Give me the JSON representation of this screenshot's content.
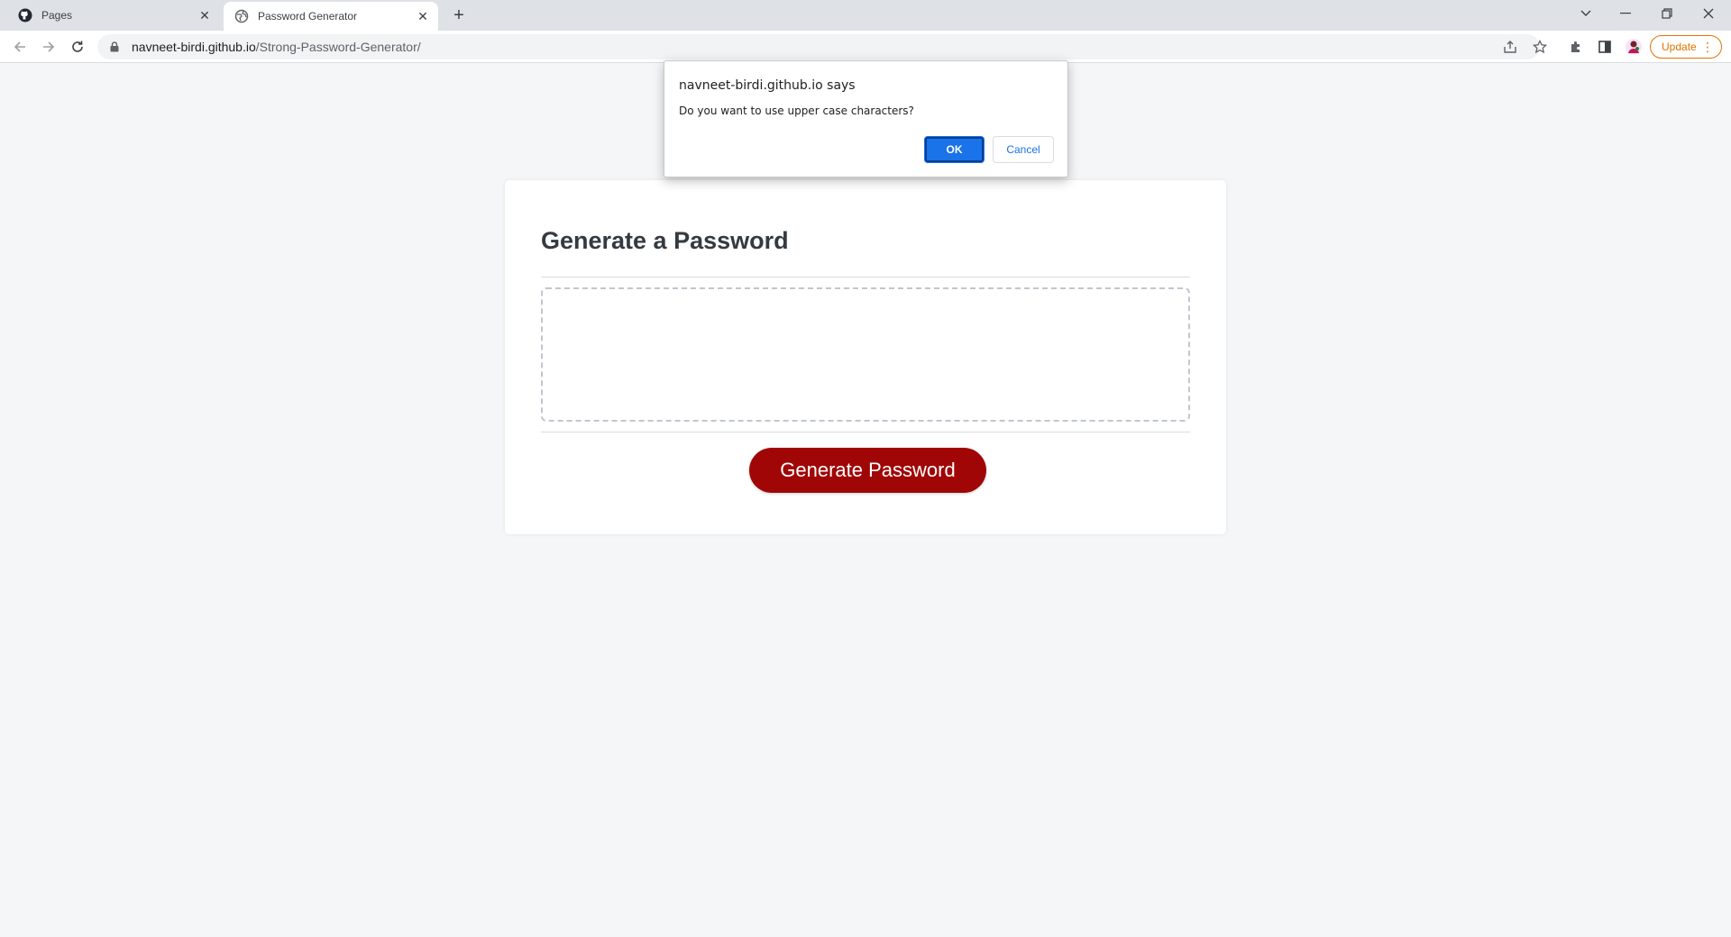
{
  "browser": {
    "tabs": [
      {
        "label": "Pages",
        "icon": "github-icon",
        "active": false
      },
      {
        "label": "Password Generator",
        "icon": "globe-icon",
        "active": true
      }
    ],
    "new_tab_label": "+",
    "url_host": "navneet-birdi.github.io",
    "url_path": "/Strong-Password-Generator/",
    "update_label": "Update",
    "menu_glyph": "⋮"
  },
  "page": {
    "heading": "Generate a Password",
    "password_value": "",
    "generate_label": "Generate Password",
    "button_color": "#a10606"
  },
  "dialog": {
    "title": "navneet-birdi.github.io says",
    "message": "Do you want to use upper case characters?",
    "ok_label": "OK",
    "cancel_label": "Cancel"
  }
}
